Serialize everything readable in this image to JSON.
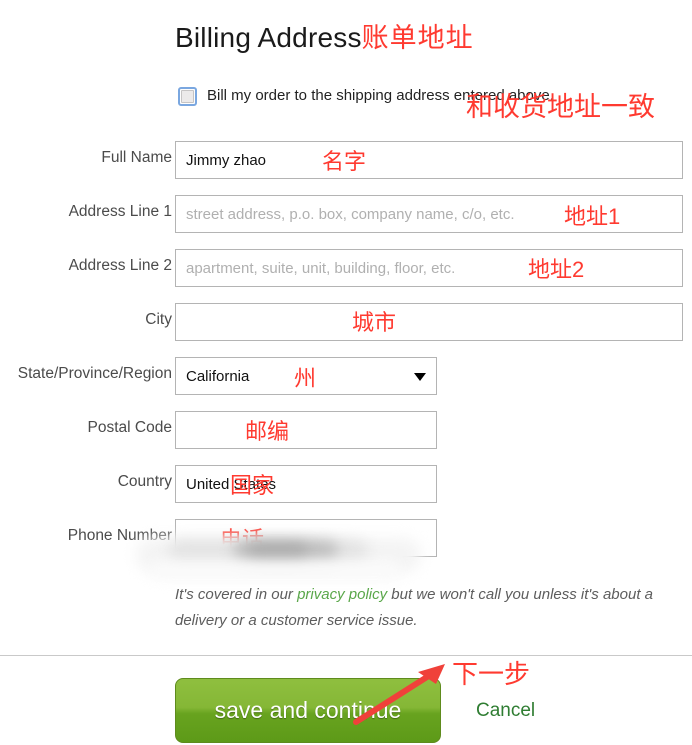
{
  "header": {
    "title_en": "Billing Address",
    "title_cn": "账单地址"
  },
  "checkbox": {
    "label": "Bill my order to the shipping address entered above.",
    "annotation_cn": "和收货地址一致",
    "checked": false
  },
  "form": {
    "fields": [
      {
        "label": "Full Name",
        "value": "Jimmy zhao",
        "placeholder": "",
        "annotation_cn": "名字",
        "width": "wide",
        "type": "text"
      },
      {
        "label": "Address Line 1",
        "value": "",
        "placeholder": "street address, p.o. box, company name, c/o, etc.",
        "annotation_cn": "地址1",
        "width": "wide",
        "type": "text"
      },
      {
        "label": "Address Line 2",
        "value": "",
        "placeholder": "apartment, suite, unit, building, floor, etc.",
        "annotation_cn": "地址2",
        "width": "wide",
        "type": "text"
      },
      {
        "label": "City",
        "value": "",
        "placeholder": "",
        "annotation_cn": "城市",
        "width": "wide",
        "type": "text"
      },
      {
        "label": "State/Province/Region",
        "value": "California",
        "placeholder": "",
        "annotation_cn": "州",
        "width": "short",
        "type": "select"
      },
      {
        "label": "Postal Code",
        "value": "",
        "placeholder": "",
        "annotation_cn": "邮编",
        "width": "short",
        "type": "text"
      },
      {
        "label": "Country",
        "value": "United States",
        "placeholder": "",
        "annotation_cn": "国家",
        "width": "short",
        "type": "text"
      },
      {
        "label": "Phone Number",
        "value": "",
        "placeholder": "",
        "annotation_cn": "电话",
        "width": "short",
        "type": "text",
        "redacted": true
      }
    ]
  },
  "privacy": {
    "text_before": "It's covered in our ",
    "link": "privacy policy",
    "text_after": " but we won't call you unless it's about a delivery or a customer service issue."
  },
  "footer": {
    "save_label": "save and continue",
    "cancel_label": "Cancel",
    "annotation_cn": "下一步"
  },
  "colors": {
    "annotation_red": "#ff3a30",
    "save_green": "#85b736",
    "link_green": "#5aa74a",
    "cancel_green": "#2f7d32",
    "field_border": "#b4b4b4"
  }
}
